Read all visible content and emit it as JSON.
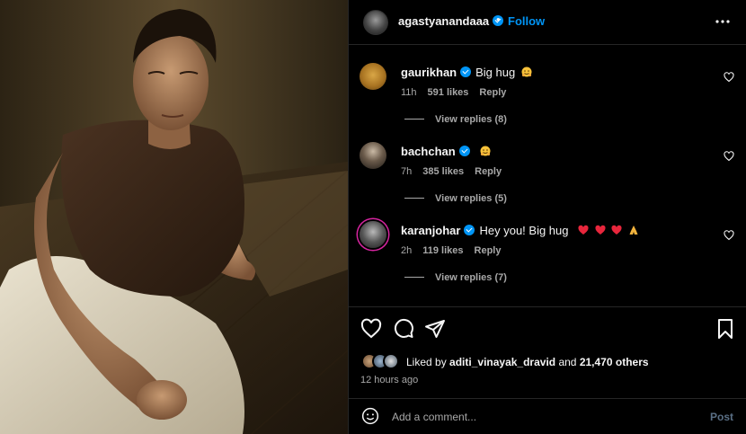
{
  "post": {
    "author": "agastyanandaaa",
    "separator": "•",
    "follow_label": "Follow",
    "more_icon": "more-horizontal-icon"
  },
  "comments": [
    {
      "username": "gaurikhan",
      "text": "Big hug",
      "emoji": "hugging-face",
      "time": "11h",
      "likes": "591 likes",
      "reply": "Reply",
      "view_replies": "View replies (8)"
    },
    {
      "username": "bachchan",
      "text": "",
      "emoji": "hugging-face",
      "time": "7h",
      "likes": "385 likes",
      "reply": "Reply",
      "view_replies": "View replies (5)"
    },
    {
      "username": "karanjohar",
      "text": "Hey you! Big hug",
      "emoji": "hearts-and-folded-hands",
      "time": "2h",
      "likes": "119 likes",
      "reply": "Reply",
      "view_replies": "View replies (7)"
    }
  ],
  "actions": {
    "like_icon": "heart-icon",
    "comment_icon": "comment-icon",
    "share_icon": "send-icon",
    "save_icon": "bookmark-icon"
  },
  "likes": {
    "prefix": "Liked by",
    "user": "aditi_vinayak_dravid",
    "joiner": "and",
    "others": "21,470 others"
  },
  "timestamp": "12 hours ago",
  "add_comment": {
    "placeholder": "Add a comment...",
    "post_label": "Post"
  },
  "colors": {
    "background": "#000000",
    "accent": "#0095f6",
    "muted_text": "#a8a8a8",
    "heart_red": "#ff3040"
  }
}
